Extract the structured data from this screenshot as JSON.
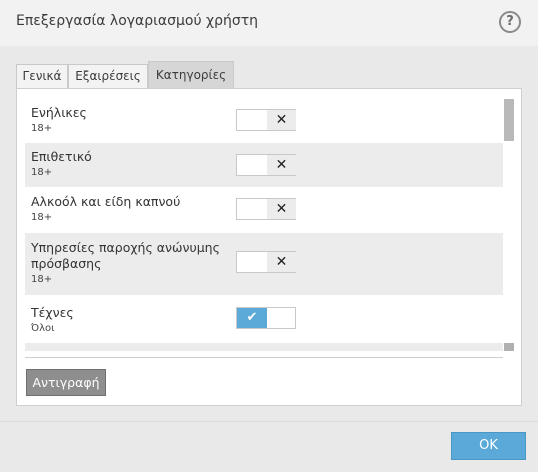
{
  "dialog": {
    "title": "Επεξεργασία λογαριασμού χρήστη",
    "help_symbol": "?"
  },
  "tabs": [
    {
      "label": "Γενικά",
      "active": false
    },
    {
      "label": "Εξαιρέσεις",
      "active": false
    },
    {
      "label": "Κατηγορίες",
      "active": true
    }
  ],
  "categories": [
    {
      "name": "Ενήλικες",
      "age": "18+",
      "enabled": false
    },
    {
      "name": "Επιθετικό",
      "age": "18+",
      "enabled": false
    },
    {
      "name": "Αλκοόλ και είδη καπνού",
      "age": "18+",
      "enabled": false
    },
    {
      "name_line1": "Υπηρεσίες παροχής ανώνυμης",
      "name_line2": "πρόσβασης",
      "age": "18+",
      "enabled": false
    },
    {
      "name": "Τέχνες",
      "age": "Όλοι",
      "enabled": true
    }
  ],
  "toggle_icons": {
    "off": "✕",
    "on": "✔"
  },
  "buttons": {
    "copy": "Αντιγραφή",
    "ok": "OK"
  },
  "colors": {
    "accent": "#5aa9d8",
    "row_alt": "#ececec"
  }
}
